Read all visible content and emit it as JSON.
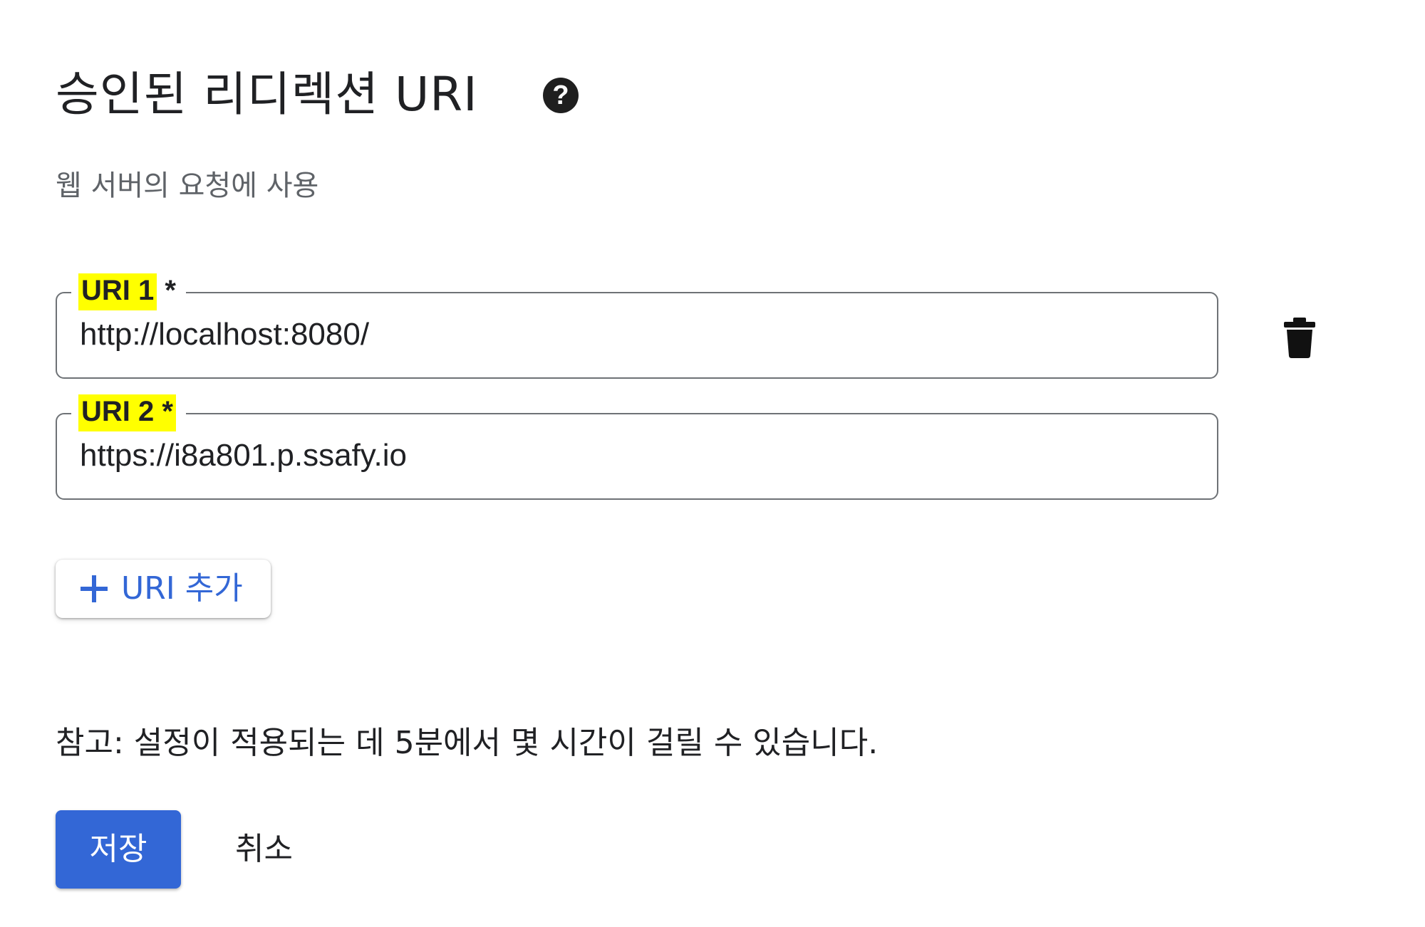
{
  "section": {
    "title": "승인된 리디렉션 URI",
    "help_icon": "help-circle-icon",
    "subtitle": "웹 서버의 요청에 사용"
  },
  "uris": [
    {
      "label": "URI 1",
      "required_marker": "*",
      "value": "http://localhost:8080/"
    },
    {
      "label": "URI 2",
      "required_marker": "*",
      "value": "https://i8a801.p.ssafy.io"
    }
  ],
  "trash_icon": "trash-icon",
  "add_uri": {
    "icon": "plus-icon",
    "label": "URI 추가"
  },
  "note": "참고: 설정이 적용되는 데 5분에서 몇 시간이 걸릴 수 있습니다.",
  "actions": {
    "save_label": "저장",
    "cancel_label": "취소"
  },
  "colors": {
    "accent": "#3367d6",
    "highlight": "#ffff00",
    "text": "#202124",
    "muted_text": "#5f6368",
    "border": "#6e7276"
  }
}
